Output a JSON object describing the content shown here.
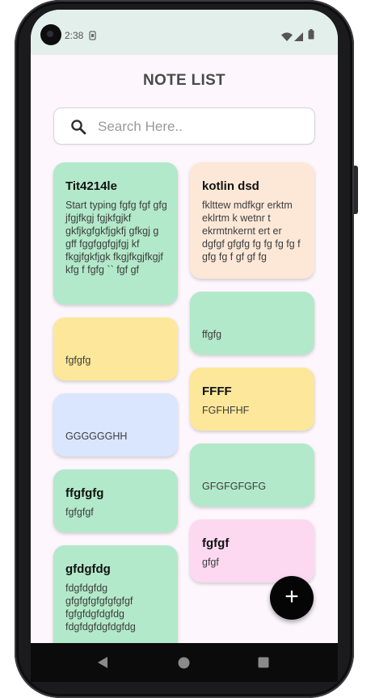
{
  "status_bar": {
    "time": "2:38",
    "icons": [
      "sim-icon",
      "wifi-icon",
      "signal-icon",
      "battery-icon"
    ]
  },
  "header": {
    "title": "NOTE LIST"
  },
  "search": {
    "placeholder": "Search Here.."
  },
  "notes": [
    {
      "title": "Tit4214le",
      "body": "Start typing fgfg fgf gfg jfgjfkgj fgjkfgjkf gkfjkgfgkfjgkfj gfkgj g gff fggfggfgjfgj kf fkgjfgkfjgk fkgjfkgjfkgjf kfg  f fgfg  ``  fgf gf",
      "color": "#b2e9ca"
    },
    {
      "title": "kotlin dsd",
      "body": "fklttew mdfkgr erktm eklrtm k wetnr t ekrmtnkernt ert er dgfgf gfgfg fg fg fg fg f gfg fg f gf gf fg",
      "color": "#fde8d8"
    },
    {
      "title": "",
      "body": "ffgfg",
      "color": "#b2e9ca"
    },
    {
      "title": "",
      "body": "fgfgfg",
      "color": "#fde79a"
    },
    {
      "title": "FFFF",
      "body": "FGFHFHF",
      "color": "#fde79a"
    },
    {
      "title": "",
      "body": "GGGGGGHH",
      "color": "#d9e6fd"
    },
    {
      "title": "",
      "body": "GFGFGFGFG",
      "color": "#b2e9ca"
    },
    {
      "title": "ffgfgfg",
      "body": "fgfgfgf",
      "color": "#b2e9ca"
    },
    {
      "title": "fgfgf",
      "body": "gfgf",
      "color": "#fcd9f1"
    },
    {
      "title": "gfdgfdg",
      "body": "fdgfdgfdg gfgfgfgfgfgfgfgf fgfgfdgfdgfdg fdgfdgfdgfdgfdg",
      "color": "#b2e9ca"
    }
  ],
  "fab": {
    "label": "+"
  },
  "nav": {
    "buttons": [
      "back-icon",
      "home-icon",
      "recents-icon"
    ]
  }
}
